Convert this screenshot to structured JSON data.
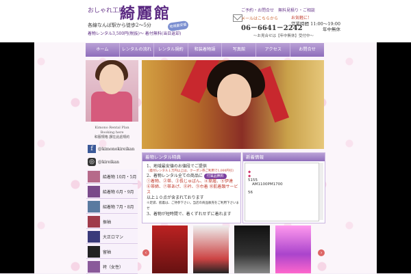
{
  "header": {
    "logo_small": "おしゃれ工房",
    "logo_main": "綺麗館",
    "access": "各線なんば駅から徒歩2～5分",
    "price_line": "着物レンタル3,500円(税抜)～ 着付無料(当日返却)",
    "badge": "地域最安値",
    "reserve": "ご予約・お問合せ　無料見積り・ご相談",
    "mail_link": "メールはこちらから",
    "eiki": "お気軽に!",
    "phone": "06－6641－2242",
    "hours": "営業時間 11:00～19:00",
    "closed": "年中無休",
    "consult": "～お見合せは【年中無休】受付中～"
  },
  "nav": [
    "ホーム",
    "レンタルの流れ",
    "レンタル規約",
    "和装着物語",
    "写真館",
    "アクセス",
    "お問合せ"
  ],
  "plan": {
    "line1": "Kimono Rental Plan",
    "line2": "Booking here",
    "line3": "和服規格 讃在此處規約"
  },
  "social": {
    "facebook": "@kimonokireikan",
    "instagram": "@kireikan"
  },
  "menu": [
    "給着物 10月・5月",
    "給着物 6月・9月",
    "紹着物 7月・8月",
    "振袖",
    "大正ロマン",
    "留袖",
    "袴（女性）"
  ],
  "campaign": {
    "title": "着物レンタル特典",
    "l1": "1、地域最安値のお値段でご提供",
    "l2": "（着付レンタル１万円以上は、クーポン券ご利用で1,000円引）",
    "l3": "2、着物レンタル全ての商品に",
    "l3_badge": "付属品無料",
    "l4": "①着物、②帯、③長じゅばん、④草履、⑤伊達",
    "l5": "⑥帯締、⑦帯あげ、⑧衿、⑨巾着 ⑩肌着類サービス",
    "l6": "以上１０点が含まれております",
    "l7": "※足袋、肌着は、ご持参下さい。当店の商品販売をご利用下さいませ",
    "l8": "3、着物が短時間で、着くずれせずに着れます"
  },
  "news": {
    "title": "新着情報",
    "diamond": "◆",
    "l1": "5155",
    "l2": "AM1100PM1700",
    "l3": "56"
  },
  "colors": {
    "accent": "#8f6dbb",
    "brand": "#5b2a82",
    "red": "#c0392b"
  }
}
